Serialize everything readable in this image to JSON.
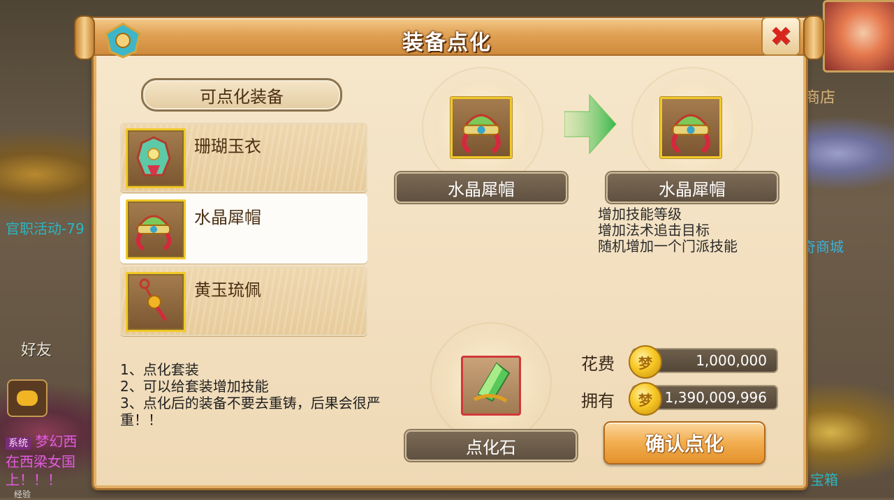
{
  "window": {
    "title": "装备点化"
  },
  "background": {
    "activity_text": "官职活动-79",
    "friend_label": "好友",
    "shop_label": "商店",
    "mall_label": "奇商城",
    "chest_label": "宝箱",
    "chat_system_tag": "系统",
    "chat_line1": "梦幻西",
    "chat_line2": "在西梁女国",
    "chat_line3": "上！！！",
    "exp_label": "经验"
  },
  "equipment_list": {
    "header": "可点化装备",
    "items": [
      {
        "name": "珊瑚玉衣",
        "icon": "robe-icon"
      },
      {
        "name": "水晶犀帽",
        "icon": "helmet-icon",
        "selected": true
      },
      {
        "name": "黄玉琉佩",
        "icon": "pendant-icon"
      }
    ]
  },
  "source_item": {
    "name": "水晶犀帽"
  },
  "result_item": {
    "name": "水晶犀帽"
  },
  "effects": [
    "增加技能等级",
    "增加法术追击目标",
    "随机增加一个门派技能"
  ],
  "notes": [
    "1、点化套装",
    "2、可以给套装增加技能",
    "3、点化后的装备不要去重铸，后果会很严重！！"
  ],
  "material": {
    "name": "点化石"
  },
  "cost": {
    "label": "花费",
    "value": "1,000,000"
  },
  "owned": {
    "label": "拥有",
    "value": "1,390,009,996"
  },
  "coin_glyph": "梦",
  "confirm_label": "确认点化",
  "close_glyph": "✖"
}
